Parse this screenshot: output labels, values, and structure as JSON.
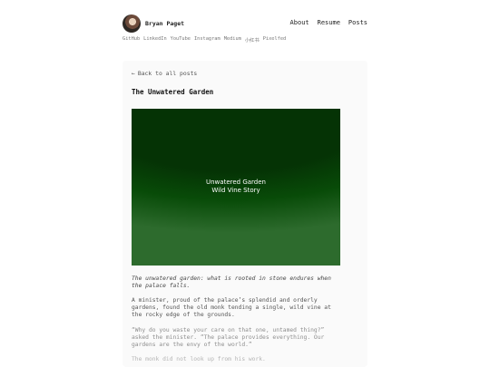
{
  "header": {
    "site_name": "Bryan Paget",
    "nav": [
      "About",
      "Resume",
      "Posts"
    ]
  },
  "social_links": [
    "GitHub",
    "LinkedIn",
    "YouTube",
    "Instagram",
    "Medium",
    "小红书",
    "Pixelfed"
  ],
  "post": {
    "back_label": "Back to all posts",
    "title": "The Unwatered Garden",
    "image_caption_line1": "Unwatered Garden",
    "image_caption_line2": "Wild Vine Story",
    "subtitle": "The unwatered garden: what is rooted in stone endures when the palace falls.",
    "paragraph1": "A minister, proud of the palace’s splendid and orderly gardens, found the old monk tending a single, wild vine at the rocky edge of the grounds.",
    "paragraph2": "“Why do you waste your care on that one, untamed thing?” asked the minister. “The palace provides everything. Our gardens are the envy of the world.”",
    "paragraph3": "The monk did not look up from his work."
  }
}
